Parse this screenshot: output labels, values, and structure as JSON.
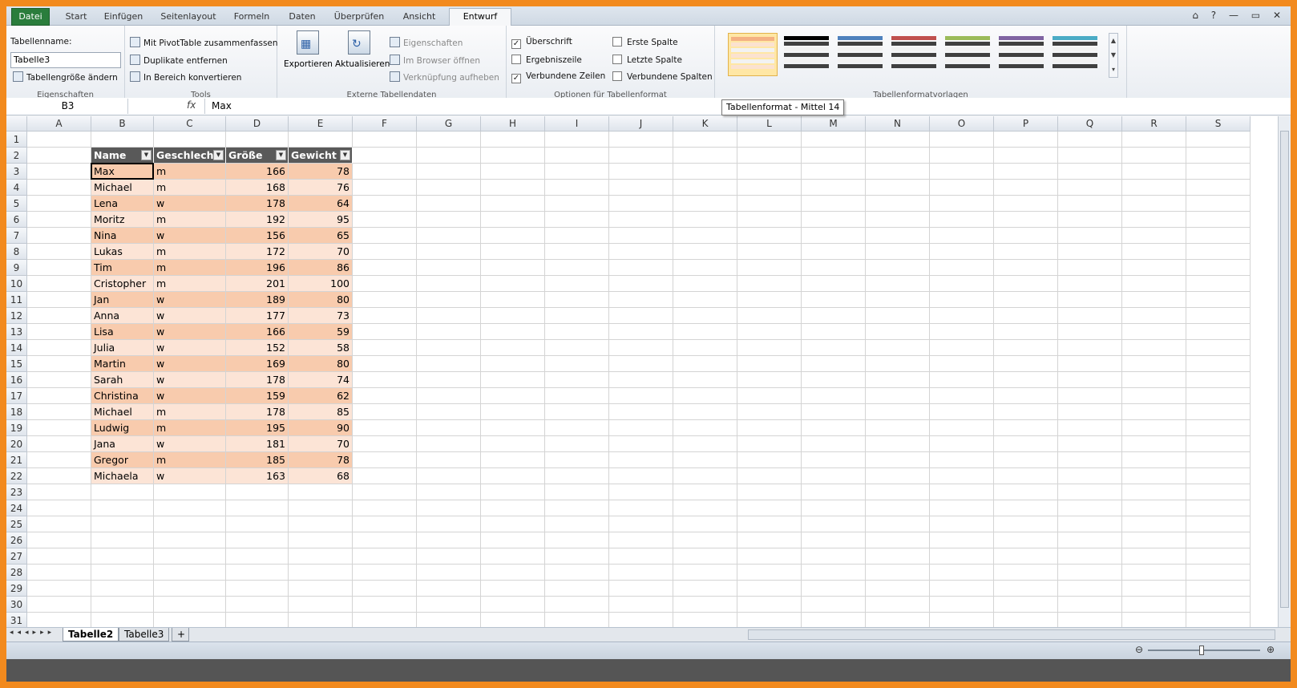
{
  "tabs": [
    "Datei",
    "Start",
    "Einfügen",
    "Seitenlayout",
    "Formeln",
    "Daten",
    "Überprüfen",
    "Ansicht",
    "Entwurf"
  ],
  "window_icons": "⌂ ? — ▭ ✕",
  "ribbon": {
    "eigenschaften": {
      "label": "Tabellenname:",
      "value": "Tabelle3",
      "resize": "Tabellengröße ändern",
      "group": "Eigenschaften"
    },
    "tools": {
      "pivot": "Mit PivotTable zusammenfassen",
      "dupes": "Duplikate entfernen",
      "convert": "In Bereich konvertieren",
      "group": "Tools"
    },
    "extern": {
      "export": "Exportieren",
      "refresh": "Aktualisieren",
      "props": "Eigenschaften",
      "browser": "Im Browser öffnen",
      "unlink": "Verknüpfung aufheben",
      "group": "Externe Tabellendaten"
    },
    "options": {
      "header": "Überschrift",
      "totals": "Ergebniszeile",
      "banded_rows": "Verbundene Zeilen",
      "first_col": "Erste Spalte",
      "last_col": "Letzte Spalte",
      "banded_cols": "Verbundene Spalten",
      "header_checked": true,
      "totals_checked": false,
      "banded_rows_checked": true,
      "first_col_checked": false,
      "last_col_checked": false,
      "banded_cols_checked": false,
      "group": "Optionen für Tabellenformat"
    },
    "styles": {
      "group": "Tabellenformatvorlagen",
      "swatches": [
        {
          "header": "#f4b183",
          "band": "#fbe2d0",
          "selected": true
        },
        {
          "header": "#000000",
          "band": "#404040",
          "selected": false
        },
        {
          "header": "#4f81bd",
          "band": "#404040",
          "selected": false
        },
        {
          "header": "#c0504d",
          "band": "#404040",
          "selected": false
        },
        {
          "header": "#9bbb59",
          "band": "#404040",
          "selected": false
        },
        {
          "header": "#8064a2",
          "band": "#404040",
          "selected": false
        },
        {
          "header": "#4bacc6",
          "band": "#404040",
          "selected": false
        }
      ]
    }
  },
  "tooltip": "Tabellenformat - Mittel 14",
  "formula_bar": {
    "name_box": "B3",
    "fx": "fx",
    "value": "Max"
  },
  "columns": [
    "A",
    "B",
    "C",
    "D",
    "E",
    "F",
    "G",
    "H",
    "I",
    "J",
    "K",
    "L",
    "M",
    "N",
    "O",
    "P",
    "Q",
    "R",
    "S"
  ],
  "table": {
    "headers": [
      "Name",
      "Geschlecht",
      "Größe",
      "Gewicht"
    ],
    "rows": [
      [
        "Max",
        "m",
        "166",
        "78"
      ],
      [
        "Michael",
        "m",
        "168",
        "76"
      ],
      [
        "Lena",
        "w",
        "178",
        "64"
      ],
      [
        "Moritz",
        "m",
        "192",
        "95"
      ],
      [
        "Nina",
        "w",
        "156",
        "65"
      ],
      [
        "Lukas",
        "m",
        "172",
        "70"
      ],
      [
        "Tim",
        "m",
        "196",
        "86"
      ],
      [
        "Cristopher",
        "m",
        "201",
        "100"
      ],
      [
        "Jan",
        "w",
        "189",
        "80"
      ],
      [
        "Anna",
        "w",
        "177",
        "73"
      ],
      [
        "Lisa",
        "w",
        "166",
        "59"
      ],
      [
        "Julia",
        "w",
        "152",
        "58"
      ],
      [
        "Martin",
        "w",
        "169",
        "80"
      ],
      [
        "Sarah",
        "w",
        "178",
        "74"
      ],
      [
        "Christina",
        "w",
        "159",
        "62"
      ],
      [
        "Michael",
        "m",
        "178",
        "85"
      ],
      [
        "Ludwig",
        "m",
        "195",
        "90"
      ],
      [
        "Jana",
        "w",
        "181",
        "70"
      ],
      [
        "Gregor",
        "m",
        "185",
        "78"
      ],
      [
        "Michaela",
        "w",
        "163",
        "68"
      ]
    ]
  },
  "colors": {
    "band_dark": "#f8cbad",
    "band_light": "#fce4d6",
    "header_bg": "#595959"
  },
  "sheets": [
    "Tabelle2",
    "Tabelle3"
  ],
  "active_sheet": "Tabelle2"
}
